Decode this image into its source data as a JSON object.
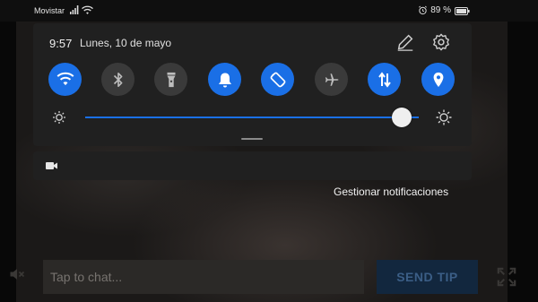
{
  "status_bar": {
    "carrier": "Movistar",
    "battery_percent": "89 %",
    "icons": [
      "signal-icon",
      "wifi-icon",
      "alarm-icon",
      "battery-icon"
    ]
  },
  "quick_settings": {
    "time": "9:57",
    "date": "Lunes, 10 de mayo",
    "header_icons": [
      "edit-icon",
      "settings-icon"
    ],
    "tiles": [
      {
        "name": "wifi",
        "icon": "wifi-icon",
        "state": "on"
      },
      {
        "name": "bluetooth",
        "icon": "bluetooth-icon",
        "state": "off"
      },
      {
        "name": "flashlight",
        "icon": "flashlight-icon",
        "state": "off"
      },
      {
        "name": "sound",
        "icon": "bell-icon",
        "state": "on"
      },
      {
        "name": "auto-rotate",
        "icon": "rotate-icon",
        "state": "on"
      },
      {
        "name": "airplane-mode",
        "icon": "airplane-icon",
        "state": "off"
      },
      {
        "name": "mobile-data",
        "icon": "data-arrows-icon",
        "state": "on"
      },
      {
        "name": "location",
        "icon": "location-pin-icon",
        "state": "on"
      }
    ],
    "brightness_level": 0.95,
    "accent_color": "#1a6fe6"
  },
  "notification": {
    "icon": "video-camera-icon"
  },
  "manage_notifications_label": "Gestionar notificaciones",
  "chat": {
    "placeholder": "Tap to chat...",
    "send_label": "SEND TIP",
    "icons": [
      "mute-icon",
      "fullscreen-icon"
    ]
  }
}
